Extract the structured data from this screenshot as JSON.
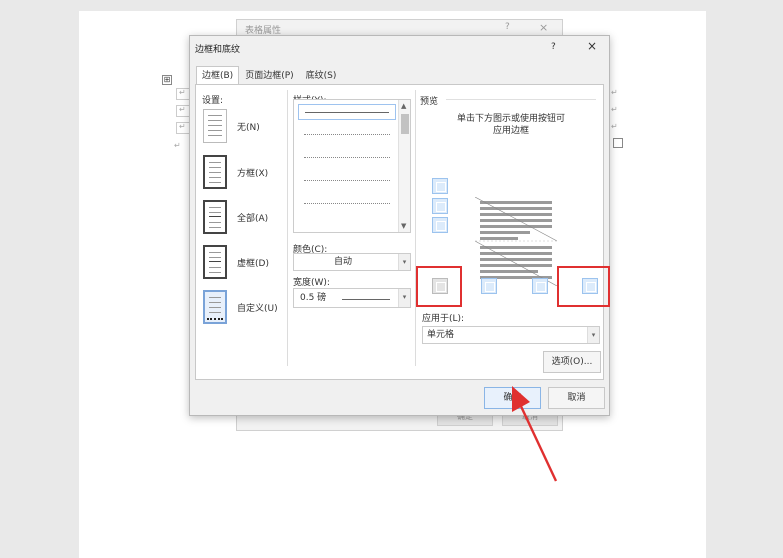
{
  "background_dialog": {
    "title": "表格属性",
    "help": "?",
    "close": "×",
    "ok": "确定",
    "cancel": "取消"
  },
  "document": {
    "table_handle": "⊞",
    "para_mark": "↵"
  },
  "dialog": {
    "title": "边框和底纹",
    "help": "?",
    "close": "×",
    "tabs": [
      {
        "label": "边框(B)",
        "active": true
      },
      {
        "label": "页面边框(P)",
        "active": false
      },
      {
        "label": "底纹(S)",
        "active": false
      }
    ],
    "settings": {
      "label": "设置:",
      "items": [
        {
          "label": "无(N)"
        },
        {
          "label": "方框(X)"
        },
        {
          "label": "全部(A)"
        },
        {
          "label": "虚框(D)"
        },
        {
          "label": "自定义(U)",
          "selected": true
        }
      ]
    },
    "style": {
      "label": "样式(Y):",
      "items": [
        "solid",
        "dotted",
        "dotted",
        "dotted",
        "dotted",
        "dash"
      ],
      "selected_index": 0
    },
    "color": {
      "label": "颜色(C):",
      "value": "自动"
    },
    "width": {
      "label": "宽度(W):",
      "value": "0.5 磅"
    },
    "preview": {
      "label": "预览",
      "hint_line1": "单击下方图示或使用按钮可",
      "hint_line2": "应用边框"
    },
    "apply_to": {
      "label": "应用于(L):",
      "value": "单元格"
    },
    "options_button": "选项(O)...",
    "ok_button": "确定",
    "cancel_button": "取消"
  },
  "annotations": {
    "highlight_color": "#e03030",
    "arrow_color": "#e03030"
  }
}
